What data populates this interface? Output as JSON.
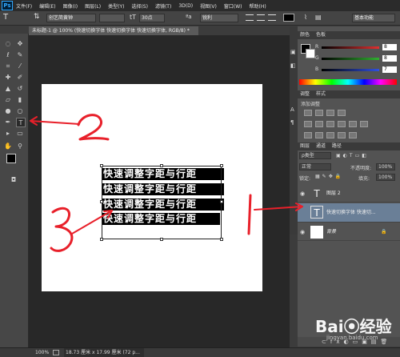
{
  "menubar": {
    "logo": "Ps",
    "items": [
      "文件(F)",
      "编辑(E)",
      "图像(I)",
      "图层(L)",
      "类型(Y)",
      "选择(S)",
      "滤镜(T)",
      "3D(D)",
      "视图(V)",
      "窗口(W)",
      "帮助(H)"
    ]
  },
  "options": {
    "font_family": "创艺简黄钟",
    "font_size": "30点",
    "antialias": "锐利",
    "workspace": "基本功能"
  },
  "document": {
    "tab_title": "未标题-1 @ 100% (快速切换字体 快速切换字体 快速切换字体, RGB/8) *",
    "text_lines": [
      "快速调整字距与行距",
      "快速调整字距与行距",
      "快速调整字距与行距",
      "快速调整字距与行距"
    ]
  },
  "status": {
    "zoom": "100%",
    "doc_info": "18.73 厘米 x 17.99 厘米 (72 p..."
  },
  "color_panel": {
    "tabs": [
      "颜色",
      "色板"
    ],
    "channels": [
      {
        "label": "R",
        "value": "8",
        "color": "#e03030"
      },
      {
        "label": "G",
        "value": "8",
        "color": "#30b030"
      },
      {
        "label": "B",
        "value": "7",
        "color": "#3050e0"
      }
    ]
  },
  "adjust_panel": {
    "tabs": [
      "调整",
      "样式"
    ],
    "title": "添加调整"
  },
  "layers_panel": {
    "tabs": [
      "图层",
      "通道",
      "路径"
    ],
    "kind_label": "ρ类型",
    "blend_mode": "正常",
    "opacity_label": "不透明度:",
    "opacity": "100%",
    "lock_label": "锁定:",
    "fill_label": "填充:",
    "fill": "100%",
    "layers": [
      {
        "name": "图层 2",
        "thumb": "T"
      },
      {
        "name": "快速切换字体 快速切...",
        "thumb": "T"
      },
      {
        "name": "背景",
        "thumb": ""
      }
    ]
  },
  "annotations": {
    "numbers": [
      "1",
      "2",
      "3"
    ],
    "color": "#e8202a"
  },
  "watermark": {
    "logo": "Bai⦿经验",
    "url": "jingyan.baidu.com"
  }
}
